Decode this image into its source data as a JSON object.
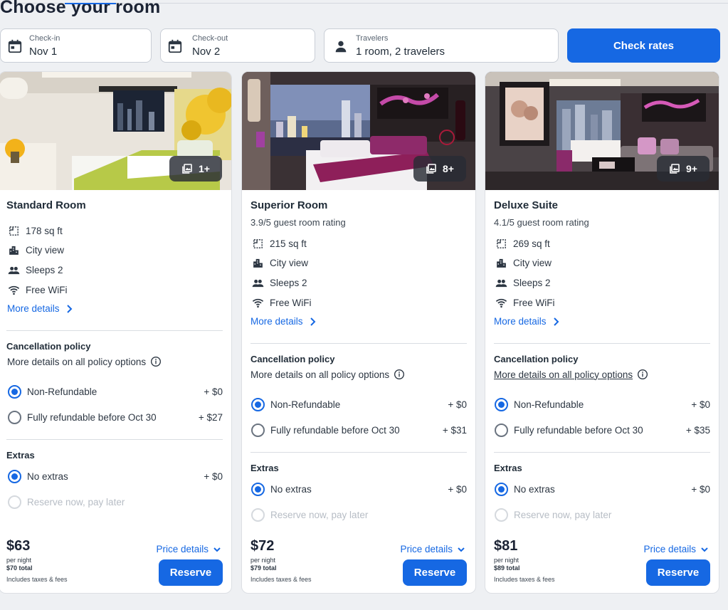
{
  "page": {
    "title": "Choose your room"
  },
  "search": {
    "checkin": {
      "label": "Check-in",
      "value": "Nov 1",
      "icon": "calendar-icon"
    },
    "checkout": {
      "label": "Check-out",
      "value": "Nov 2",
      "icon": "calendar-icon"
    },
    "travelers": {
      "label": "Travelers",
      "value": "1 room, 2 travelers",
      "icon": "person-icon"
    },
    "button": "Check rates"
  },
  "colors": {
    "accent": "#1668e3",
    "background": "#eef0f3"
  },
  "common": {
    "more_details": "More details",
    "cancellation_heading": "Cancellation policy",
    "policy_link": "More details on all policy options",
    "non_refundable": "Non-Refundable",
    "extras_heading": "Extras",
    "no_extras": "No extras",
    "reserve_later": "Reserve now, pay later",
    "per_night": "per night",
    "taxes_note": "Includes taxes & fees",
    "price_details": "Price details",
    "reserve": "Reserve"
  },
  "rooms": [
    {
      "name": "Standard Room",
      "gallery": "1+",
      "area": "178 sq ft",
      "view": "City view",
      "sleeps": "Sleeps 2",
      "wifi": "Free WiFi",
      "non_refundable_price": "+ $0",
      "refundable_label": "Fully refundable before Oct 30",
      "refundable_price": "+ $27",
      "no_extras_price": "+ $0",
      "price": "$63",
      "total": "$70 total"
    },
    {
      "name": "Superior Room",
      "rating": "3.9/5 guest room rating",
      "gallery": "8+",
      "area": "215 sq ft",
      "view": "City view",
      "sleeps": "Sleeps 2",
      "wifi": "Free WiFi",
      "non_refundable_price": "+ $0",
      "refundable_label": "Fully refundable before Oct 30",
      "refundable_price": "+ $31",
      "no_extras_price": "+ $0",
      "price": "$72",
      "total": "$79 total"
    },
    {
      "name": "Deluxe Suite",
      "rating": "4.1/5 guest room rating",
      "gallery": "9+",
      "area": "269 sq ft",
      "view": "City view",
      "sleeps": "Sleeps 2",
      "wifi": "Free WiFi",
      "non_refundable_price": "+ $0",
      "refundable_label": "Fully refundable before Oct 30",
      "refundable_price": "+ $35",
      "no_extras_price": "+ $0",
      "price": "$81",
      "total": "$89 total"
    }
  ]
}
